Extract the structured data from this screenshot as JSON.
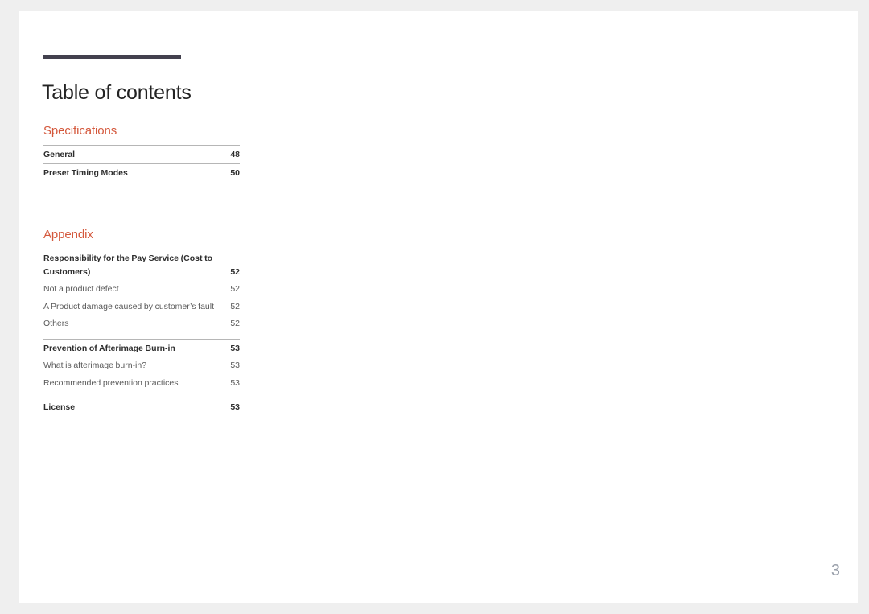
{
  "document": {
    "title": "Table of contents",
    "folio": "3",
    "accent_color": "#d4583c",
    "rule_color": "#43414e"
  },
  "sections": [
    {
      "heading": "Specifications",
      "groups": [
        {
          "entries": [
            {
              "label": "General",
              "page": "48",
              "bold": true,
              "ruled": true
            },
            {
              "label": "Preset Timing Modes",
              "page": "50",
              "bold": true,
              "ruled": true
            }
          ]
        }
      ]
    },
    {
      "heading": "Appendix",
      "groups": [
        {
          "entries": [
            {
              "label": "Responsibility for the Pay Service (Cost to Customers)",
              "page": "52",
              "bold": true,
              "ruled": false
            },
            {
              "label": "Not a product defect",
              "page": "52",
              "bold": false,
              "ruled": false
            },
            {
              "label": "A Product damage caused by customer’s fault",
              "page": "52",
              "bold": false,
              "ruled": false
            },
            {
              "label": "Others",
              "page": "52",
              "bold": false,
              "ruled": false
            }
          ]
        },
        {
          "entries": [
            {
              "label": "Prevention of Afterimage Burn-in",
              "page": "53",
              "bold": true,
              "ruled": false
            },
            {
              "label": "What is afterimage burn-in?",
              "page": "53",
              "bold": false,
              "ruled": false
            },
            {
              "label": "Recommended prevention practices",
              "page": "53",
              "bold": false,
              "ruled": false
            }
          ]
        },
        {
          "entries": [
            {
              "label": "License",
              "page": "53",
              "bold": true,
              "ruled": false
            }
          ]
        }
      ]
    }
  ]
}
